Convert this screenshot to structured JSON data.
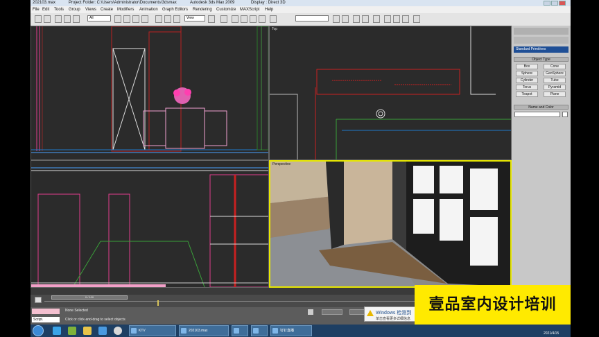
{
  "window": {
    "file_title": "202103.max",
    "project_folder": "Project Folder: C:\\Users\\Administrator\\Documents\\3dsmax",
    "app_title": "Autodesk 3ds Max  2009",
    "display_mode": "Display : Direct 3D"
  },
  "menu": [
    "File",
    "Edit",
    "Tools",
    "Group",
    "Views",
    "Create",
    "Modifiers",
    "Animation",
    "Graph Editors",
    "Rendering",
    "Customize",
    "MAXScript",
    "Help"
  ],
  "toolbar": {
    "filter_select": "All",
    "view_select": "View"
  },
  "viewports": {
    "top_right_label": "Top",
    "perspective_label": "Perspective"
  },
  "command_panel": {
    "category": "Standard Primitives",
    "rollout_object_type": "Object Type",
    "objects": [
      "Box",
      "Cone",
      "Sphere",
      "GeoSphere",
      "Cylinder",
      "Tube",
      "Torus",
      "Pyramid",
      "Teapot",
      "Plane"
    ],
    "rollout_name_color": "Name and Color"
  },
  "timeline": {
    "frame_counter": "0 / 100"
  },
  "status": {
    "selection": "None Selected",
    "prompt": "Click or click-and-drag to select objects",
    "script_label": "Script."
  },
  "winpopup": {
    "title": "Windows 检测到",
    "text": "单击查看更多详细信息"
  },
  "taskbar": {
    "items": [
      "KTV",
      "202103.max",
      "",
      "",
      "钉钉直播"
    ],
    "date": "2021/4/15"
  },
  "watermark": "壹品室内设计培训"
}
